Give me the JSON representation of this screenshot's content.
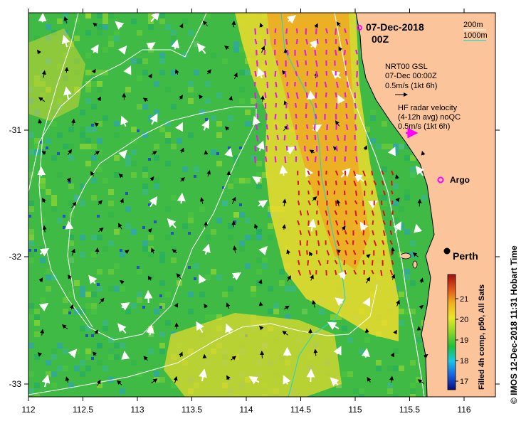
{
  "title": {
    "date": "07-Dec-2018",
    "time": "00Z"
  },
  "depth_legend": [
    {
      "label": "200m",
      "color": "#ffffff"
    },
    {
      "label": "1000m",
      "color": "#27d3c8"
    }
  ],
  "model_legend": {
    "line1": "NRT00 GSL",
    "line2": "07-Dec 00:00Z",
    "line3": "0.5m/s (1kt 6h)",
    "arrow_color": "#000000"
  },
  "radar_legend": {
    "line1": "HF radar velocity",
    "line2": "(4-12h avg) noQC",
    "line3": "0.5m/s (1kt 6h)",
    "arrow_color": "#ff00ff"
  },
  "argo": {
    "label": "Argo",
    "color": "#ff00ff"
  },
  "city": {
    "label": "Perth"
  },
  "x_axis": {
    "ticks": [
      "112",
      "112.5",
      "113",
      "113.5",
      "114",
      "114.5",
      "115",
      "115.5",
      "116"
    ]
  },
  "y_axis": {
    "ticks": [
      "-31",
      "-32",
      "-33"
    ]
  },
  "colorbar": {
    "label": "Filled 4h comp, p50, All Sats",
    "ticks": [
      "17",
      "18",
      "19",
      "20",
      "21"
    ],
    "colors": [
      "#0a0a7a",
      "#1a5fe0",
      "#19c7e6",
      "#1fbf3a",
      "#8bd62a",
      "#e8e82a",
      "#f2b21f",
      "#e0531a",
      "#a01010"
    ]
  },
  "credit": "© IMOS 12-Dec-2018 11:31 Hobart Time",
  "colors": {
    "land": "#fbc49a",
    "ocean_base": "#3fbb45",
    "warm_patch": "#eedc2c",
    "orange_patch": "#f4a323"
  }
}
